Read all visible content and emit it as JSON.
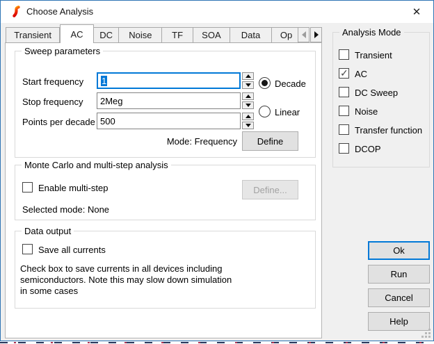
{
  "window": {
    "title": "Choose Analysis",
    "close_glyph": "✕"
  },
  "tabs": {
    "items": [
      "Transient",
      "AC",
      "DC",
      "Noise",
      "TF",
      "SOA",
      "Data",
      "Op"
    ],
    "active": "AC"
  },
  "sweep": {
    "legend": "Sweep parameters",
    "fields": [
      {
        "label": "Start frequency",
        "value": "1",
        "focused": true
      },
      {
        "label": "Stop frequency",
        "value": "2Meg",
        "focused": false
      },
      {
        "label": "Points per decade",
        "value": "500",
        "focused": false
      }
    ],
    "radios": [
      {
        "label": "Decade",
        "selected": true
      },
      {
        "label": "Linear",
        "selected": false
      }
    ],
    "mode_label": "Mode: Frequency",
    "define_button": "Define"
  },
  "monte_carlo": {
    "legend": "Monte Carlo and multi-step analysis",
    "checkbox_label": "Enable multi-step",
    "checkbox_checked": false,
    "define_button": "Define...",
    "selected_mode": "Selected mode: None"
  },
  "data_output": {
    "legend": "Data output",
    "checkbox_label": "Save all currents",
    "checkbox_checked": false,
    "note_lines": [
      "Check box to save currents in all devices including",
      "semiconductors. Note this may slow down simulation",
      "in some cases"
    ]
  },
  "analysis_mode": {
    "legend": "Analysis Mode",
    "items": [
      {
        "label": "Transient",
        "checked": false
      },
      {
        "label": "AC",
        "checked": true
      },
      {
        "label": "DC Sweep",
        "checked": false
      },
      {
        "label": "Noise",
        "checked": false
      },
      {
        "label": "Transfer function",
        "checked": false
      },
      {
        "label": "DCOP",
        "checked": false
      }
    ]
  },
  "action_buttons": {
    "ok": "Ok",
    "run": "Run",
    "cancel": "Cancel",
    "help": "Help"
  },
  "colors": {
    "accent": "#0078d7",
    "window_border": "#2e75b5",
    "selection_bg": "#0078d7"
  }
}
